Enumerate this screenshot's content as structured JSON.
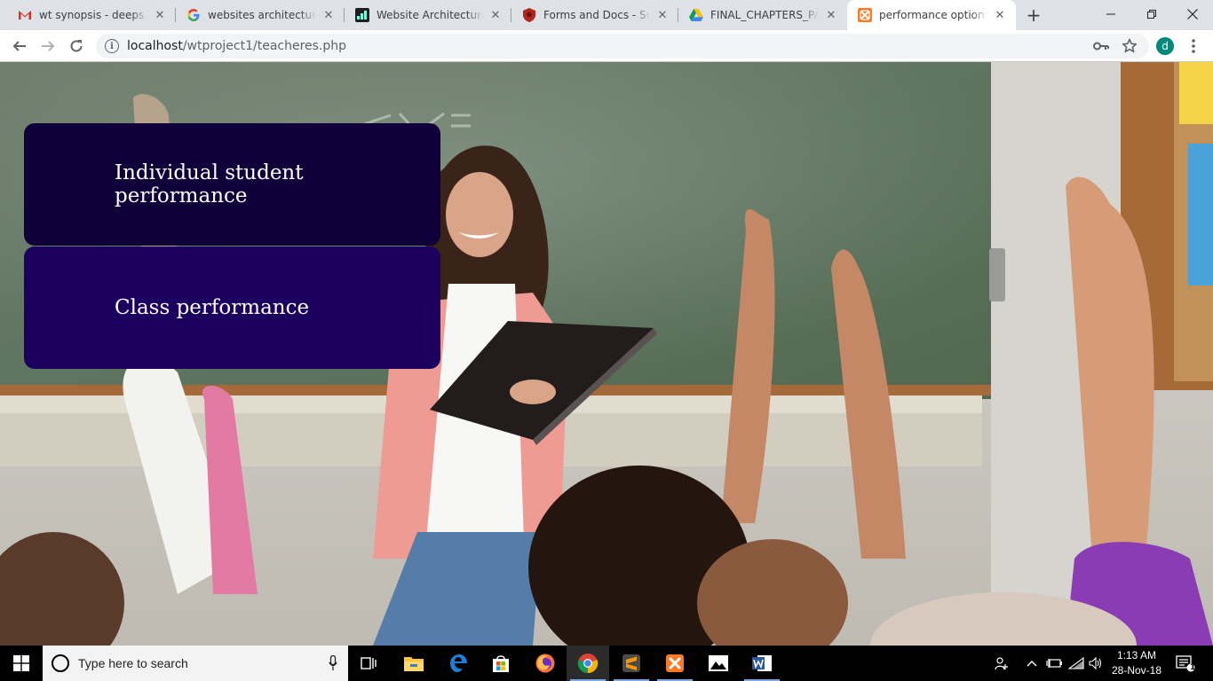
{
  "browser": {
    "tabs": [
      {
        "title": "wt synopsis - deeps.nag",
        "icon": "gmail-icon",
        "active": false
      },
      {
        "title": "websites architecture - ",
        "icon": "google-icon",
        "active": false
      },
      {
        "title": "Website Architecture &",
        "icon": "site-icon",
        "active": false
      },
      {
        "title": "Forms and Docs - Suma",
        "icon": "shield-icon",
        "active": false
      },
      {
        "title": "FINAL_CHAPTERS_PAGE",
        "icon": "drive-icon",
        "active": false
      },
      {
        "title": "performance options",
        "icon": "xampp-icon",
        "active": true
      }
    ],
    "new_tab_label": "+",
    "address": {
      "host": "localhost",
      "path": "/wtproject1/teacheres.php"
    },
    "profile_initial": "d"
  },
  "page": {
    "options": [
      {
        "label": "Individual student performance"
      },
      {
        "label": "Class performance"
      }
    ],
    "colors": {
      "option_1": "#10003a",
      "option_2": "#1b0060"
    }
  },
  "taskbar": {
    "search_placeholder": "Type here to search",
    "apps": [
      "task-view",
      "file-explorer",
      "edge",
      "store",
      "firefox",
      "chrome",
      "sublime-text",
      "xampp",
      "photos",
      "word"
    ],
    "clock": {
      "time": "1:13 AM",
      "date": "28-Nov-18"
    },
    "notification_count": "1"
  }
}
